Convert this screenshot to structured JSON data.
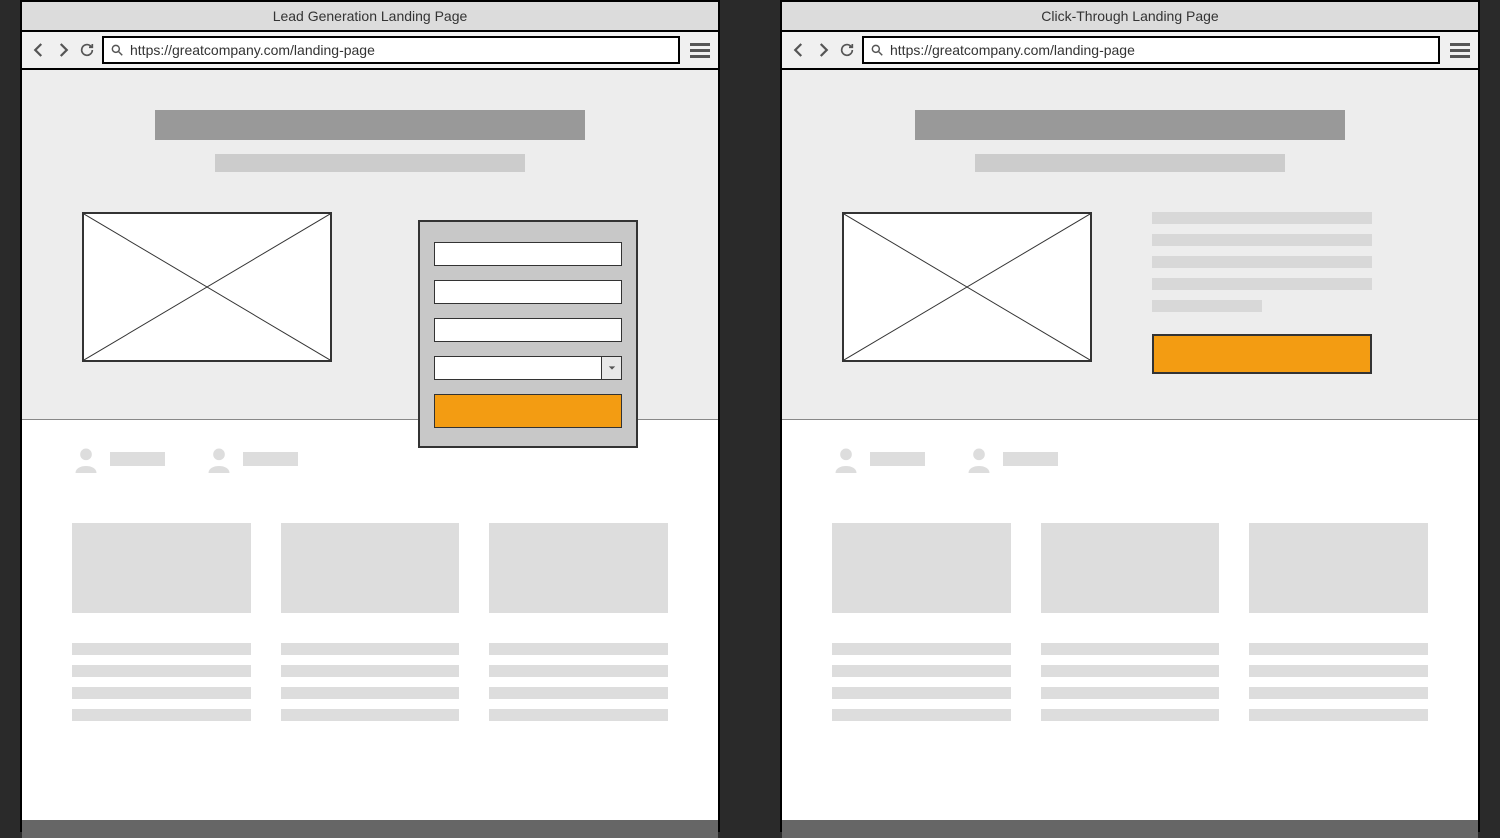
{
  "left": {
    "title": "Lead Generation Landing Page",
    "url": "https://greatcompany.com/landing-page"
  },
  "right": {
    "title": "Click-Through Landing Page",
    "url": "https://greatcompany.com/landing-page"
  },
  "colors": {
    "cta": "#f39c12",
    "placeholder_dark": "#999999",
    "placeholder_light": "#cccccc"
  }
}
